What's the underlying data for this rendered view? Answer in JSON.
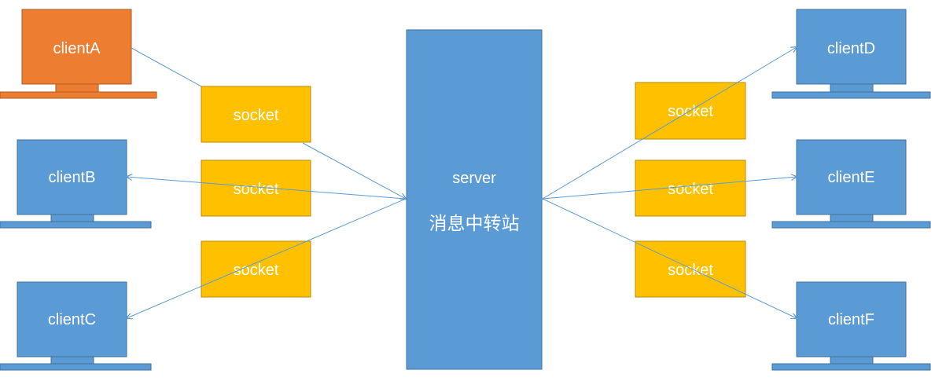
{
  "colors": {
    "client": "#5B9BD5",
    "client_highlight": "#ED7D31",
    "server": "#5B9BD5",
    "socket": "#FFC000",
    "connector": "#5B9BD5",
    "text": "#FFFFFF"
  },
  "server": {
    "label": "server",
    "subtitle": "消息中转站"
  },
  "clients": [
    {
      "id": "A",
      "label": "clientA",
      "highlight": true
    },
    {
      "id": "B",
      "label": "clientB",
      "highlight": false
    },
    {
      "id": "C",
      "label": "clientC",
      "highlight": false
    },
    {
      "id": "D",
      "label": "clientD",
      "highlight": false
    },
    {
      "id": "E",
      "label": "clientE",
      "highlight": false
    },
    {
      "id": "F",
      "label": "clientF",
      "highlight": false
    }
  ],
  "sockets": [
    {
      "label": "socket"
    },
    {
      "label": "socket"
    },
    {
      "label": "socket"
    },
    {
      "label": "socket"
    },
    {
      "label": "socket"
    },
    {
      "label": "socket"
    }
  ]
}
